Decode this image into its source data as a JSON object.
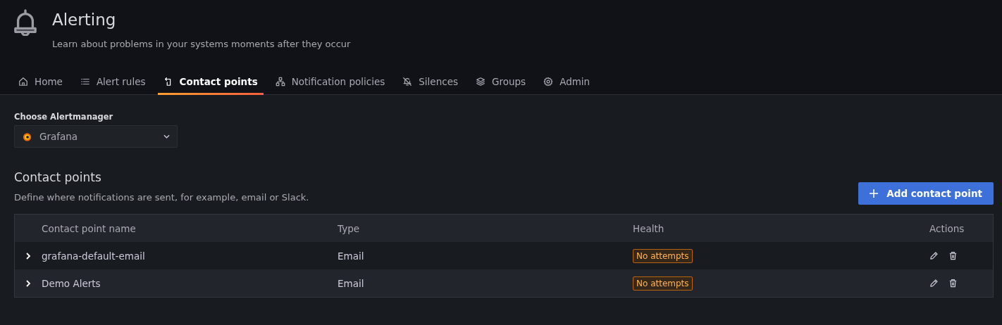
{
  "header": {
    "title": "Alerting",
    "subtitle": "Learn about problems in your systems moments after they occur"
  },
  "tabs": [
    {
      "label": "Home",
      "selected": false
    },
    {
      "label": "Alert rules",
      "selected": false
    },
    {
      "label": "Contact points",
      "selected": true
    },
    {
      "label": "Notification policies",
      "selected": false
    },
    {
      "label": "Silences",
      "selected": false
    },
    {
      "label": "Groups",
      "selected": false
    },
    {
      "label": "Admin",
      "selected": false
    }
  ],
  "alertmanager": {
    "label": "Choose Alertmanager",
    "value": "Grafana"
  },
  "section": {
    "title": "Contact points",
    "description": "Define where notifications are sent, for example, email or Slack.",
    "add_button": "Add contact point"
  },
  "table": {
    "columns": [
      "Contact point name",
      "Type",
      "Health",
      "Actions"
    ],
    "rows": [
      {
        "name": "grafana-default-email",
        "type": "Email",
        "health": "No attempts",
        "expanded": false
      },
      {
        "name": "Demo Alerts",
        "type": "Email",
        "health": "No attempts",
        "expanded": false
      }
    ]
  }
}
